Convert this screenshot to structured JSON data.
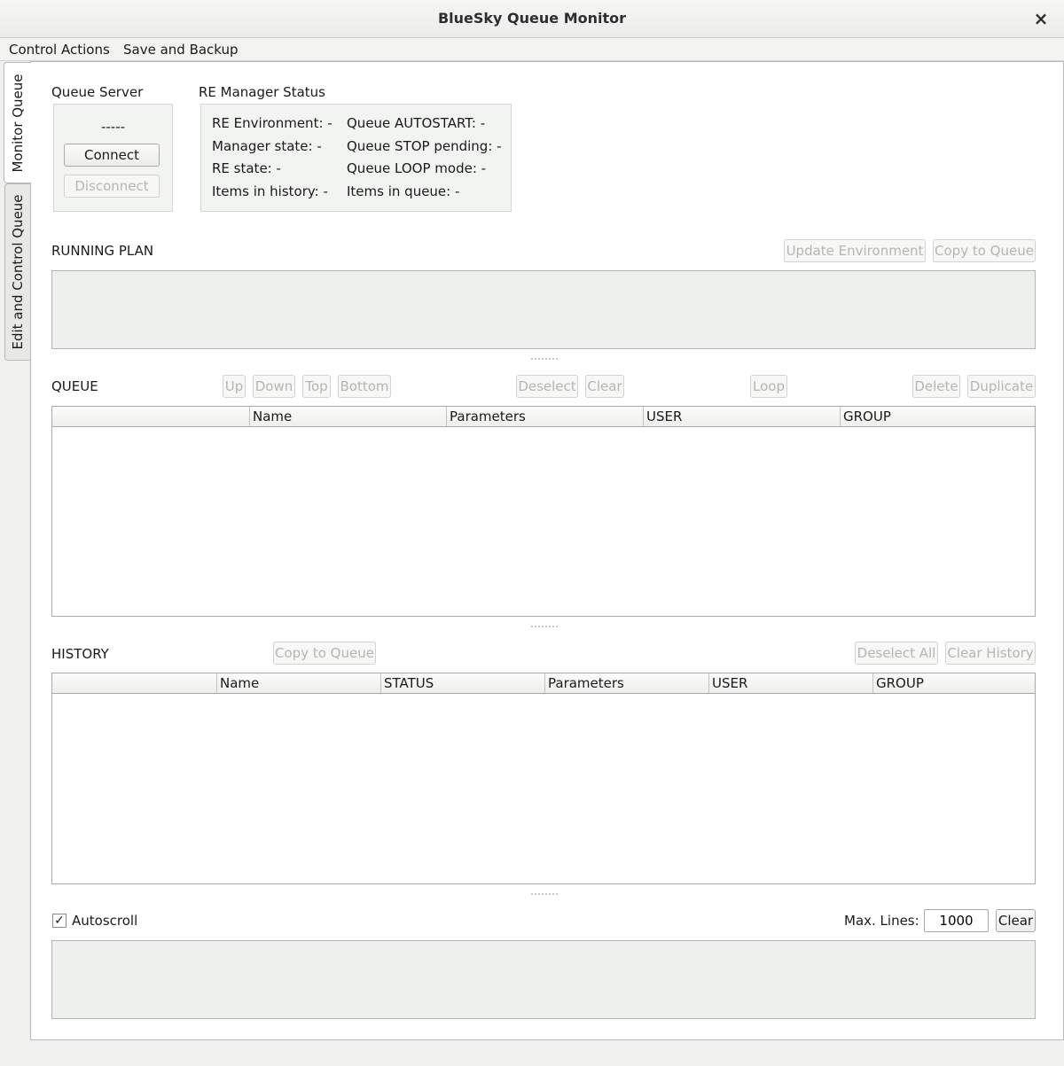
{
  "window": {
    "title": "BlueSky Queue Monitor",
    "close_glyph": "×"
  },
  "menu": {
    "items": [
      "Control Actions",
      "Save and Backup"
    ]
  },
  "side_tabs": [
    {
      "label": "Monitor Queue",
      "active": true
    },
    {
      "label": "Edit and Control Queue",
      "active": false
    }
  ],
  "queue_server": {
    "heading": "Queue Server",
    "status": "-----",
    "connect_label": "Connect",
    "disconnect_label": "Disconnect"
  },
  "re_manager": {
    "heading": "RE Manager Status",
    "left": [
      "RE Environment: -",
      "Manager state: -",
      "RE state: -",
      "Items in history: -"
    ],
    "right": [
      "Queue AUTOSTART: -",
      "Queue STOP pending: -",
      "Queue LOOP mode: -",
      "Items in queue: -"
    ]
  },
  "running_plan": {
    "heading": "RUNNING PLAN",
    "update_env_label": "Update Environment",
    "copy_label": "Copy to Queue"
  },
  "queue": {
    "heading": "QUEUE",
    "buttons": {
      "up": "Up",
      "down": "Down",
      "top": "Top",
      "bottom": "Bottom",
      "deselect": "Deselect",
      "clear": "Clear",
      "loop": "Loop",
      "delete": "Delete",
      "duplicate": "Duplicate"
    },
    "columns": [
      "",
      "Name",
      "Parameters",
      "USER",
      "GROUP"
    ],
    "rows": []
  },
  "history": {
    "heading": "HISTORY",
    "copy_label": "Copy to Queue",
    "deselect_all_label": "Deselect All",
    "clear_history_label": "Clear History",
    "columns": [
      "",
      "Name",
      "STATUS",
      "Parameters",
      "USER",
      "GROUP"
    ],
    "rows": []
  },
  "console": {
    "autoscroll_label": "Autoscroll",
    "autoscroll_checked": true,
    "check_glyph": "✓",
    "max_lines_label": "Max. Lines:",
    "max_lines_value": "1000",
    "clear_label": "Clear"
  }
}
